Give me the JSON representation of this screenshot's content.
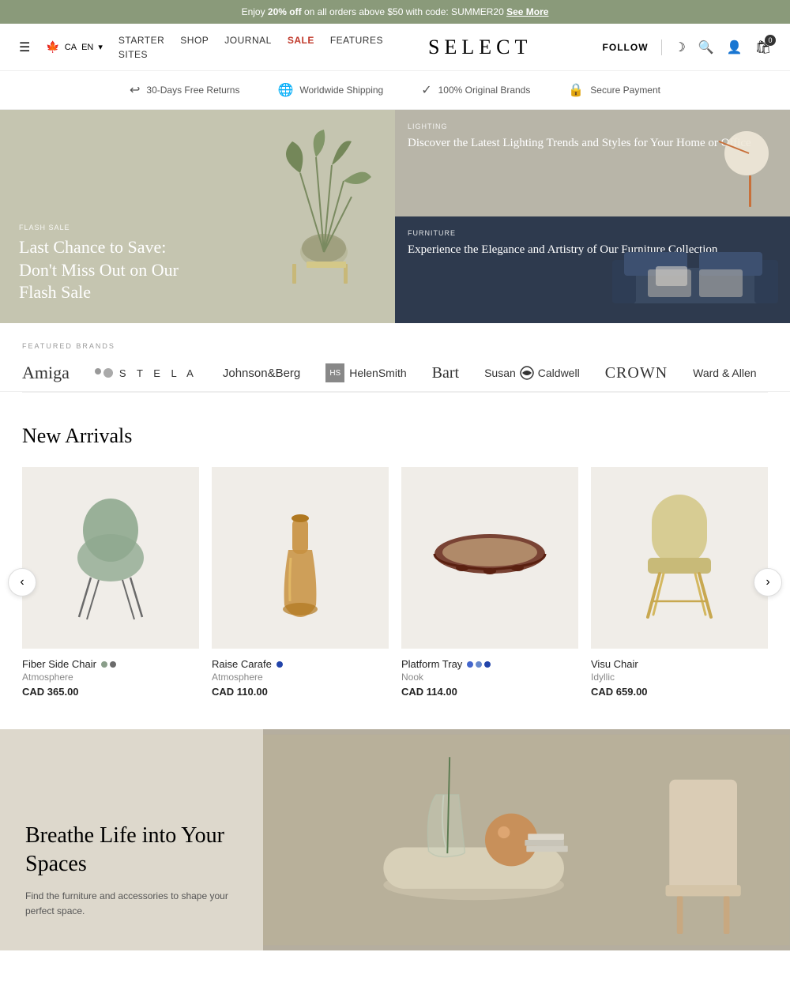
{
  "topBanner": {
    "text": "Enjoy ",
    "highlight": "20% off",
    "textAfter": " on all orders above $50 with code: SUMMER20",
    "linkText": "See More"
  },
  "nav": {
    "menuLabel": "☰",
    "links": [
      {
        "label": "STARTER SITES",
        "href": "#",
        "class": ""
      },
      {
        "label": "SHOP",
        "href": "#",
        "class": ""
      },
      {
        "label": "JOURNAL",
        "href": "#",
        "class": ""
      },
      {
        "label": "SALE",
        "href": "#",
        "class": "sale"
      },
      {
        "label": "FEATURES",
        "href": "#",
        "class": ""
      }
    ],
    "logo": "SELECT",
    "followLabel": "FOLLOW",
    "moonIcon": "☽",
    "searchIcon": "⌕",
    "userIcon": "⌀",
    "cartIcon": "⊠",
    "cartCount": "0",
    "locale": "CA",
    "lang": "EN"
  },
  "trustBar": [
    {
      "icon": "↩",
      "text": "30-Days Free Returns"
    },
    {
      "icon": "⊕",
      "text": "Worldwide Shipping"
    },
    {
      "icon": "✓",
      "text": "100% Original Brands"
    },
    {
      "icon": "⚿",
      "text": "Secure Payment"
    }
  ],
  "hero": {
    "left": {
      "badge": "FLASH SALE",
      "title": "Last Chance to Save: Don't Miss Out on Our Flash Sale"
    },
    "topRight": {
      "badge": "LIGHTING",
      "title": "Discover the Latest Lighting Trends and Styles for Your Home or Office"
    },
    "bottomRight": {
      "badge": "FURNITURE",
      "title": "Experience the Elegance and Artistry of Our Furniture Collection"
    }
  },
  "brands": {
    "label": "FEATURED BRANDS",
    "items": [
      {
        "name": "Amiga",
        "style": "serif"
      },
      {
        "name": "STELA",
        "style": "spaced"
      },
      {
        "name": "Johnson&Berg",
        "style": "sans"
      },
      {
        "name": "HelenSmith",
        "style": "hs"
      },
      {
        "name": "Bart",
        "style": "serif"
      },
      {
        "name": "Susan S Caldwell",
        "style": "logo"
      },
      {
        "name": "CROWN",
        "style": "serif"
      },
      {
        "name": "Ward & Allen",
        "style": "sans"
      }
    ]
  },
  "newArrivals": {
    "sectionTitle": "New Arrivals",
    "products": [
      {
        "name": "Fiber Side Chair",
        "brand": "Atmosphere",
        "price": "CAD 365.00",
        "colors": [
          "#8a9e8a",
          "#6b6b6b"
        ]
      },
      {
        "name": "Raise Carafe",
        "brand": "Atmosphere",
        "price": "CAD 110.00",
        "colors": [
          "#2244aa"
        ]
      },
      {
        "name": "Platform Tray",
        "brand": "Nook",
        "price": "CAD 114.00",
        "colors": [
          "#4466cc",
          "#6688cc",
          "#2244aa"
        ]
      },
      {
        "name": "Visu Chair",
        "brand": "Idyllic",
        "price": "CAD 659.00",
        "colors": []
      }
    ]
  },
  "bottomHero": {
    "title": "Breathe Life into Your Spaces",
    "subtitle": "Find the furniture and accessories to shape your perfect space."
  }
}
